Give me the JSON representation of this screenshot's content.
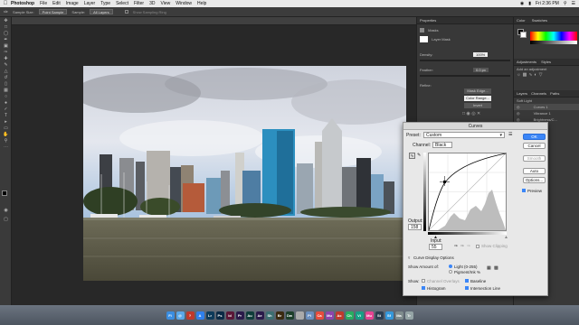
{
  "menubar": {
    "app": "Photoshop",
    "items": [
      "File",
      "Edit",
      "Image",
      "Layer",
      "Type",
      "Select",
      "Filter",
      "3D",
      "View",
      "Window",
      "Help"
    ],
    "clock": "Fri 2:36 PM"
  },
  "options": {
    "sample_size_label": "Sample Size:",
    "sample_size_value": "Point Sample",
    "sample_label": "Sample:",
    "sample_value": "All Layers",
    "show_ring": "Show Sampling Ring"
  },
  "panels": {
    "properties_tab": "Properties",
    "masks_label": "Masks",
    "layer_mask_label": "Layer Mask",
    "density_label": "Density:",
    "density_value": "100%",
    "feather_label": "Feather:",
    "feather_value": "0.0 px",
    "refine_label": "Refine:",
    "mask_edge": "Mask Edge...",
    "color_range": "Color Range...",
    "invert": "Invert",
    "color_tab": "Color",
    "swatches_tab": "Swatches",
    "adjustments_tab": "Adjustments",
    "styles_tab": "Styles",
    "add_adjustment": "Add an adjustment",
    "layers_tab": "Layers",
    "channels_tab": "Channels",
    "paths_tab": "Paths",
    "blend_mode": "Soft Light",
    "layers": [
      "Curves 1",
      "Vibrance 1",
      "Brightness/C...",
      "Layer 2"
    ]
  },
  "curves": {
    "title": "Curves",
    "preset_label": "Preset:",
    "preset_value": "Custom",
    "channel_label": "Channel:",
    "channel_value": "Black",
    "output_label": "Output:",
    "output_value": "158",
    "input_label": "Input:",
    "input_value": "55",
    "show_clipping": "Show Clipping",
    "display_options": "Curve Display Options",
    "show_amount_label": "Show Amount of:",
    "light_option": "Light  (0-255)",
    "pigment_option": "Pigment/Ink %",
    "show_label": "Show:",
    "channel_overlays": "Channel Overlays",
    "baseline": "Baseline",
    "histogram": "Histogram",
    "intersection_line": "Intersection Line",
    "ok": "OK",
    "cancel": "Cancel",
    "smooth": "Smooth",
    "auto": "Auto",
    "options": "Options...",
    "preview": "Preview"
  },
  "dock": {
    "apps": [
      "Fi",
      "@",
      "?",
      "A",
      "Lr",
      "Ps",
      "Id",
      "Pr",
      "Au",
      "Ae",
      "Sh",
      "Br",
      "Dw",
      " ",
      "Pl",
      "Ca",
      "Mu",
      "Ac",
      "Ch",
      "Vi",
      "Mu",
      "St",
      "Sf",
      "Ma",
      "Tr"
    ]
  }
}
